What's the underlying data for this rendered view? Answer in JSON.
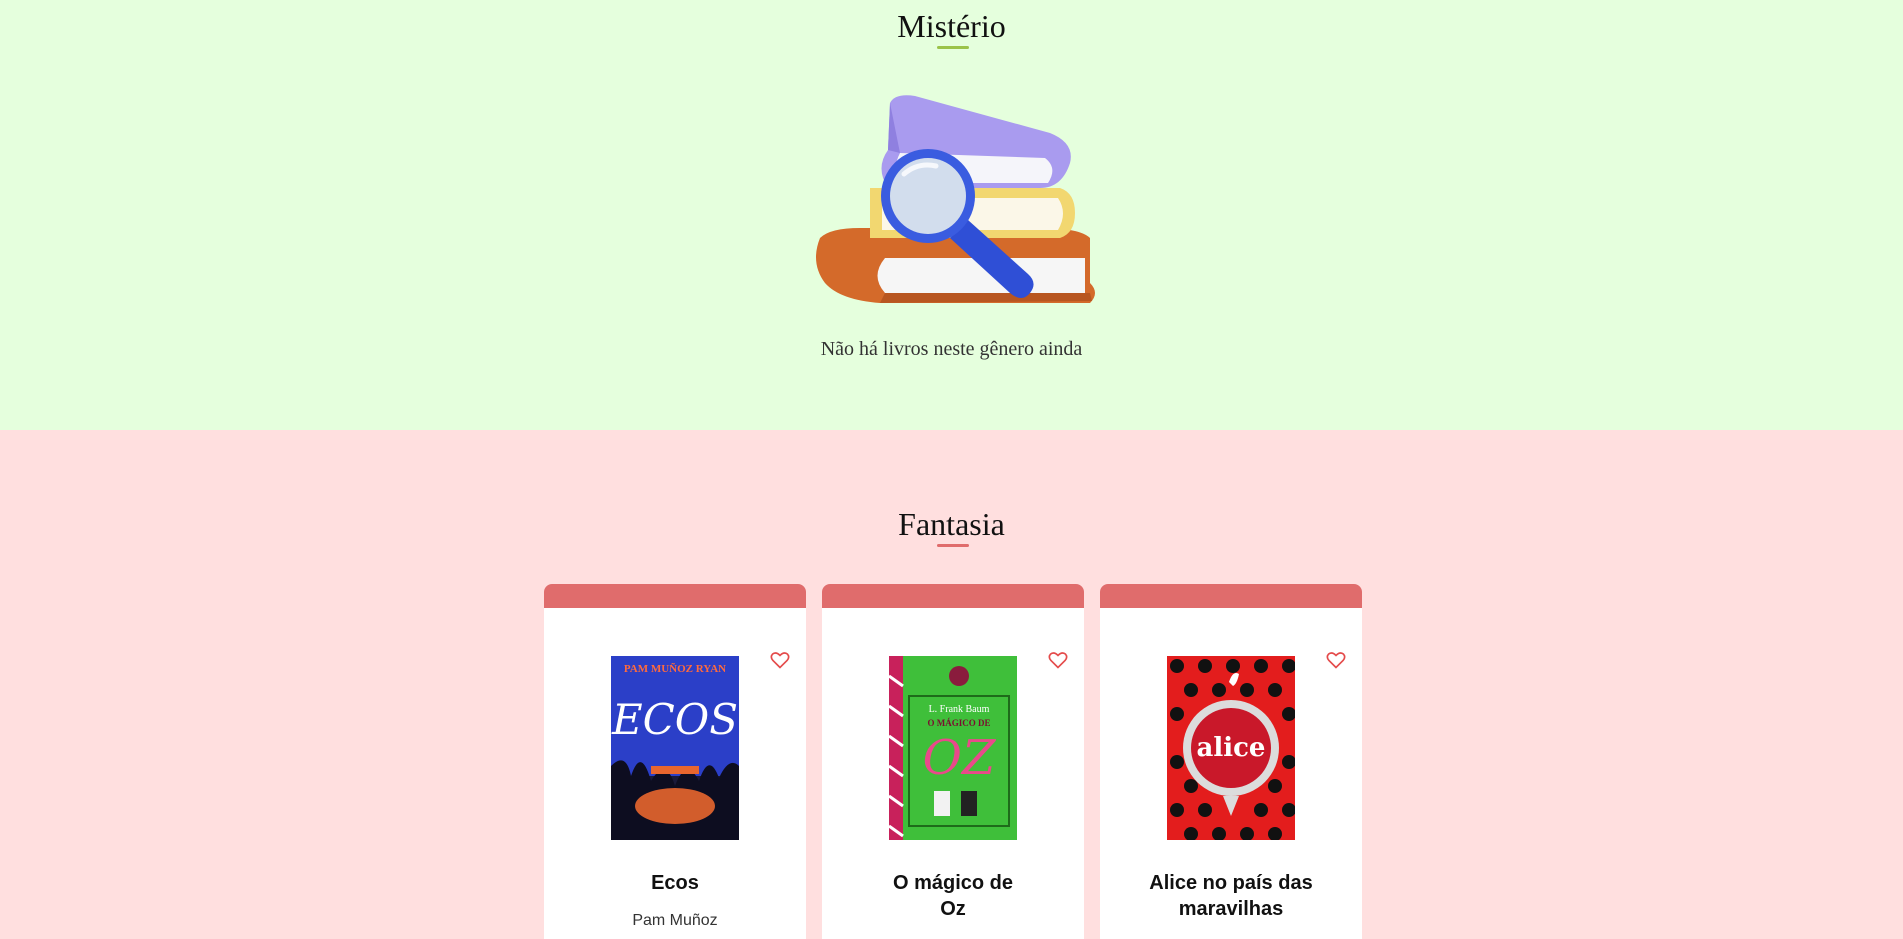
{
  "colors": {
    "mystery_bg": "#e5ffdd",
    "mystery_accent": "#9bc34a",
    "fantasy_bg": "#ffdfdf",
    "fantasy_accent": "#e06c6c",
    "heart": "#e44b4b"
  },
  "mystery": {
    "title": "Mistério",
    "empty_message": "Não há livros neste gênero ainda",
    "illustration": "books-magnifier-icon"
  },
  "fantasy": {
    "title": "Fantasia",
    "books": [
      {
        "title": "Ecos",
        "author": "Pam Muñoz",
        "cover_text": "ECOS",
        "cover_author": "PAM MUÑOZ RYAN"
      },
      {
        "title": "O mágico de Oz",
        "author": "",
        "cover_text": "OZ",
        "cover_author": "L. Frank Baum",
        "cover_subtitle": "O MÁGICO DE"
      },
      {
        "title": "Alice no país das maravilhas",
        "author": "",
        "cover_text": "alice"
      }
    ]
  }
}
